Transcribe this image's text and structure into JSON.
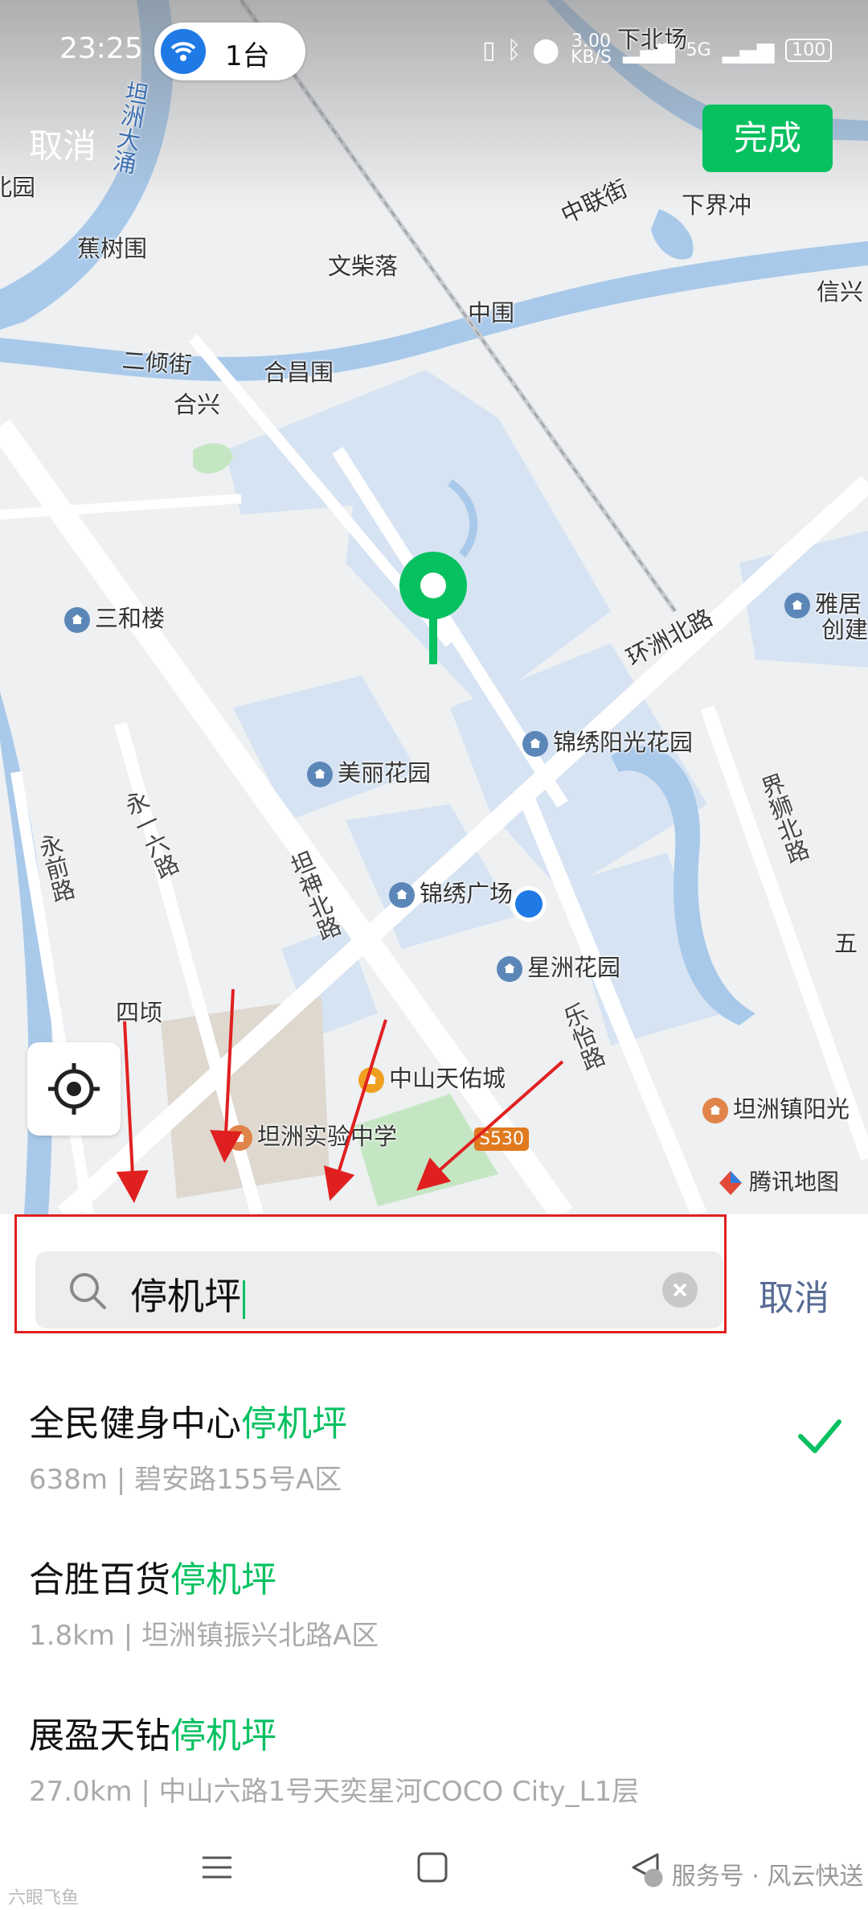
{
  "status": {
    "time": "23:25",
    "hotspot_label": "1台",
    "net_speed": "3.00\nKB/S",
    "net_speed_line1": "3.00",
    "net_speed_line2": "KB/S",
    "signal_5g": "5G",
    "battery": "100"
  },
  "header": {
    "cancel_label": "取消",
    "done_label": "完成"
  },
  "map": {
    "labels": {
      "xiabeichang": "下北场",
      "tanzhoudachong": "坦洲大涌",
      "zhonglianjie": "中联街",
      "xiajiechong": "下界冲",
      "bei": "北园",
      "jiaoshuwei": "蕉树围",
      "wenchailuo": "文柴落",
      "xinxing": "信兴",
      "zhongwei": "中围",
      "erqingjie": "二倾街",
      "hechangwei": "合昌围",
      "hexing": "合兴",
      "sanhelou": "三和楼",
      "huanzhoubeilu": "环洲北路",
      "yaju": "雅居",
      "chuangjian": "创建",
      "jinxiuyangguang": "锦绣阳光花园",
      "meilihuayuan": "美丽花园",
      "yongyiliulu": "永一六路",
      "jieshibeilu": "界狮北路",
      "yongqianlu": "永前路",
      "tanshenbeilu": "坦神北路",
      "jinxiuguangchang": "锦绣广场",
      "wu": "五",
      "xingzhouhuayuan": "星洲花园",
      "siqing": "四顷",
      "leyilu": "乐怡路",
      "zhongshantianyoucheng": "中山天佑城",
      "tanzhoushiyan": "坦洲实验中学",
      "s530": "S530",
      "tanzhouzhenyangguang": "坦洲镇阳光",
      "tencent_map": "腾讯地图"
    }
  },
  "search": {
    "query": "停机坪",
    "cancel_label": "取消"
  },
  "results": [
    {
      "prefix": "全民健身中心",
      "highlight": "停机坪",
      "detail": "638m | 碧安路155号A区",
      "selected": true
    },
    {
      "prefix": "合胜百货",
      "highlight": "停机坪",
      "detail": "1.8km | 坦洲镇振兴北路A区",
      "selected": false
    },
    {
      "prefix": "展盈天钻",
      "highlight": "停机坪",
      "detail": "27.0km | 中山六路1号天奕星河COCO City_L1层",
      "selected": false
    }
  ],
  "watermark": {
    "text": "服务号 · 风云快送",
    "corner": "六眼飞鱼"
  },
  "colors": {
    "accent": "#07c160",
    "link": "#576b95",
    "annotation": "#e02020",
    "location_dot": "#1f7ae6"
  }
}
